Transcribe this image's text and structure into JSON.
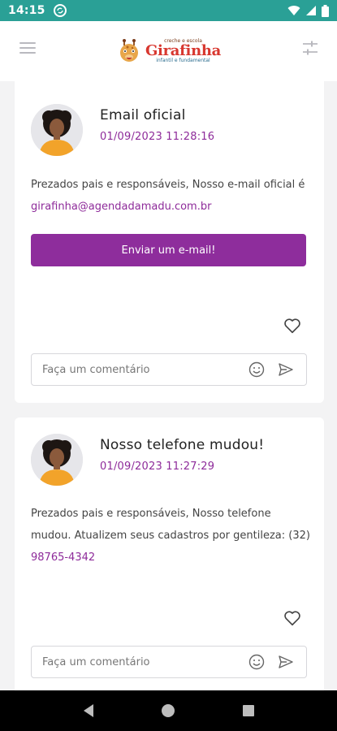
{
  "status_bar": {
    "time": "14:15",
    "sync_icon": "sync-badge-icon",
    "icons": [
      "wifi-icon",
      "signal-icon",
      "battery-icon"
    ]
  },
  "header": {
    "logo": {
      "top_line": "creche e escola",
      "name": "Girafinha",
      "bottom_line": "infantil e fundamental"
    },
    "menu_icon": "hamburger-menu-icon",
    "filter_icon": "filter-sliders-icon"
  },
  "posts": [
    {
      "title": "Email oficial",
      "date": "01/09/2023 11:28:16",
      "body_text": "Prezados pais e responsáveis, Nosso e-mail oficial é ",
      "body_link": "girafinha@agendadamadu.com.br",
      "cta_label": "Enviar um e-mail!",
      "comment_placeholder": "Faça um comentário"
    },
    {
      "title": "Nosso telefone mudou!",
      "date": "01/09/2023 11:27:29",
      "body_text": "Prezados pais e responsáveis, Nosso telefone mudou. Atualizem seus cadastros por gentileza: (32) ",
      "body_link": "98765-4342",
      "comment_placeholder": "Faça um comentário"
    }
  ],
  "colors": {
    "status_bar": "#2aa096",
    "accent": "#8e2d9c",
    "background": "#f3f3f4"
  },
  "nav_bar": {
    "icons": [
      "back-icon",
      "home-icon",
      "recents-icon"
    ]
  }
}
